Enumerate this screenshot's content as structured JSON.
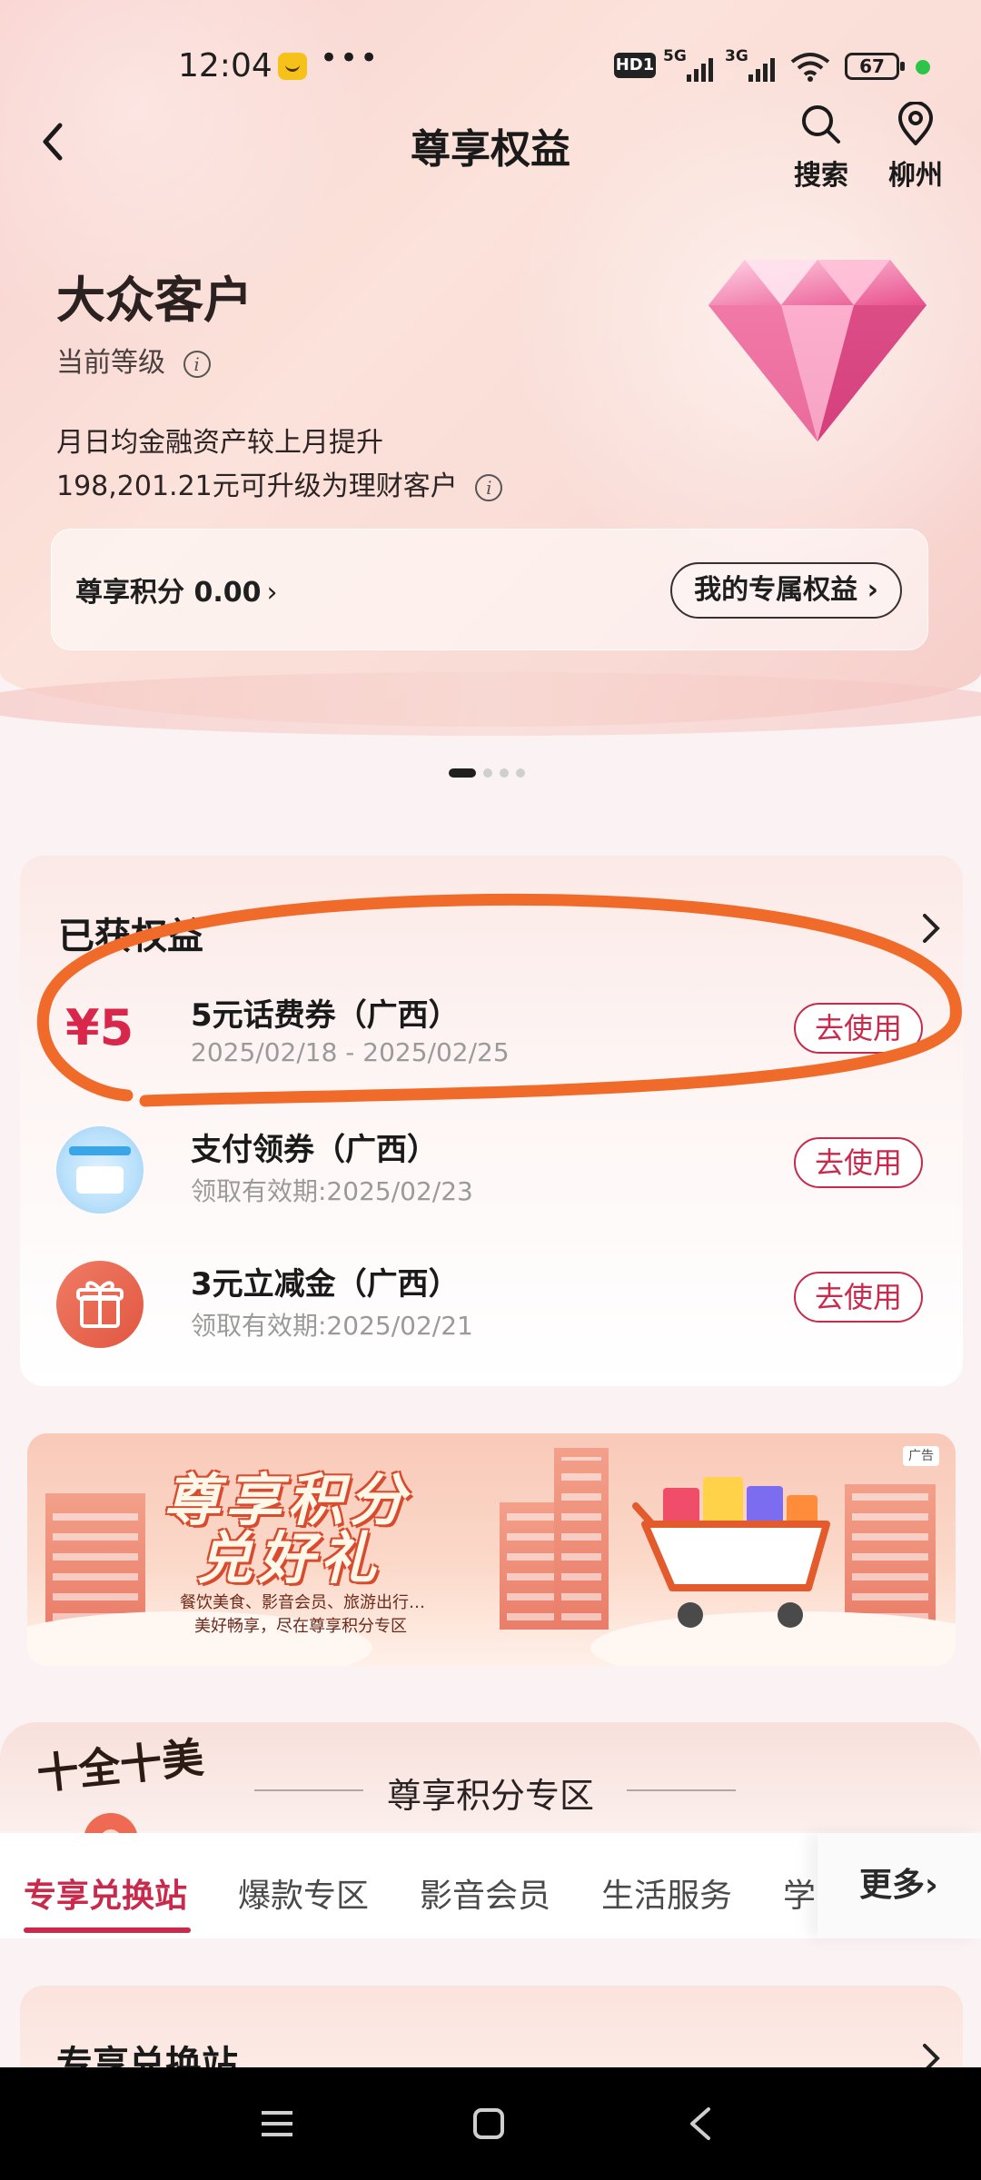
{
  "status_bar": {
    "time": "12:04",
    "dots": "•••",
    "hd": "HD1",
    "net1": "5G",
    "net2": "3G",
    "battery": "67"
  },
  "nav": {
    "title": "尊享权益",
    "search_label": "搜索",
    "city_label": "柳州"
  },
  "level": {
    "name": "大众客户",
    "caption": "当前等级",
    "upgrade_line1": "月日均金融资产较上月提升",
    "upgrade_line2": "198,201.21元可升级为理财客户",
    "points_label": "尊享积分 0.00",
    "my_rights_button": "我的专属权益"
  },
  "benefits": {
    "title": "已获权益",
    "items": [
      {
        "thumb_text": "¥5",
        "name": "5元话费券（广西）",
        "date": "2025/02/18 - 2025/02/25",
        "action": "去使用"
      },
      {
        "thumb_text": "",
        "name": "支付领券（广西）",
        "date": "领取有效期:2025/02/23",
        "action": "去使用"
      },
      {
        "thumb_text": "",
        "name": "3元立减金（广西）",
        "date": "领取有效期:2025/02/21",
        "action": "去使用"
      }
    ]
  },
  "ad": {
    "title_line1": "尊享积分",
    "title_line2": "兑好礼",
    "sub1": "餐饮美食、影音会员、旅游出行…",
    "sub2": "美好畅享，尽在尊享积分专区",
    "tag": "广告"
  },
  "zone": {
    "logo_text": "十全十美",
    "title": "尊享积分专区",
    "tabs": [
      "专享兑换站",
      "爆款专区",
      "影音会员",
      "生活服务",
      "学"
    ],
    "more": "更多",
    "exchange_title": "专享兑换站"
  },
  "colors": {
    "accent": "#c9294b",
    "annotation": "#f06a2a"
  }
}
